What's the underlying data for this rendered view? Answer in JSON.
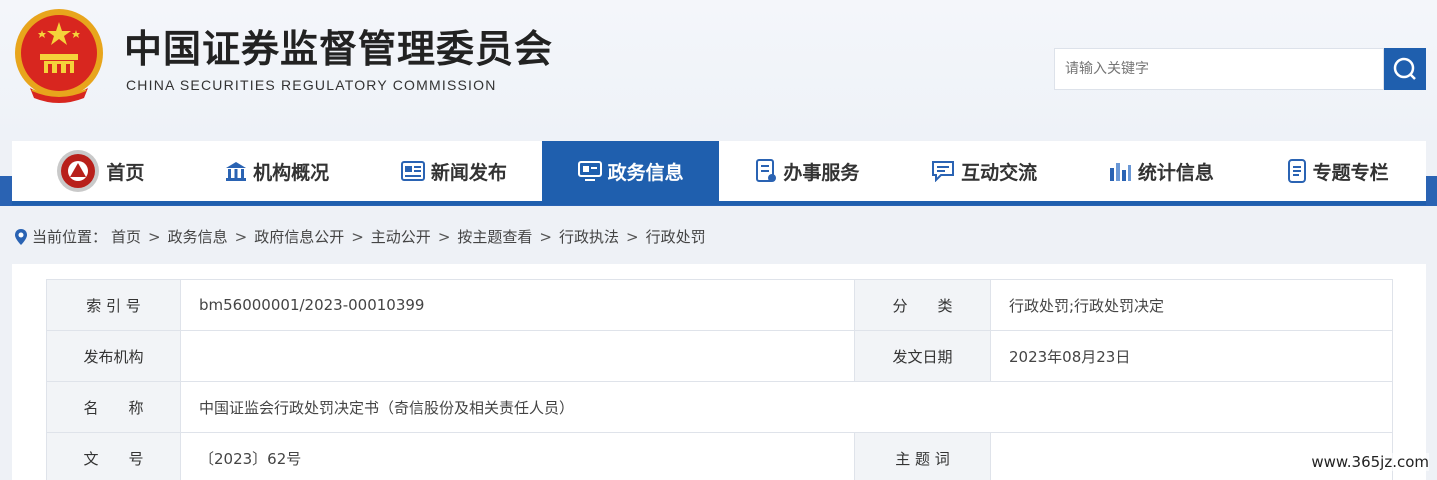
{
  "header": {
    "title_cn": "中国证券监督管理委员会",
    "title_en": "CHINA SECURITIES REGULATORY COMMISSION",
    "emblem_icon": "national-emblem-icon"
  },
  "search": {
    "placeholder": "请输入关键字",
    "button_icon": "search-icon"
  },
  "nav": {
    "items": [
      {
        "label": "首页",
        "icon": "home-emblem-icon",
        "active": false
      },
      {
        "label": "机构概况",
        "icon": "building-icon",
        "active": false
      },
      {
        "label": "新闻发布",
        "icon": "news-icon",
        "active": false
      },
      {
        "label": "政务信息",
        "icon": "monitor-icon",
        "active": true
      },
      {
        "label": "办事服务",
        "icon": "document-service-icon",
        "active": false
      },
      {
        "label": "互动交流",
        "icon": "chat-icon",
        "active": false
      },
      {
        "label": "统计信息",
        "icon": "bar-chart-icon",
        "active": false
      },
      {
        "label": "专题专栏",
        "icon": "column-icon",
        "active": false
      }
    ],
    "active_color": "#1f5fae"
  },
  "breadcrumb": {
    "prefix": "当前位置：",
    "items": [
      "首页",
      "政务信息",
      "政府信息公开",
      "主动公开",
      "按主题查看",
      "行政执法",
      "行政处罚"
    ],
    "separator": ">",
    "icon": "location-pin-icon"
  },
  "meta_table": {
    "rows": [
      {
        "label1": "索 引 号",
        "value1": "bm56000001/2023-00010399",
        "label2": "分　　类",
        "value2": "行政处罚;行政处罚决定"
      },
      {
        "label1": "发布机构",
        "value1": "",
        "label2": "发文日期",
        "value2": "2023年08月23日"
      },
      {
        "label1": "名　　称",
        "value1": "中国证监会行政处罚决定书（奇信股份及相关责任人员）"
      },
      {
        "label1": "文　　号",
        "value1": "〔2023〕62号",
        "label2": "主 题 词",
        "value2": ""
      }
    ]
  },
  "watermark": "www.365jz.com"
}
